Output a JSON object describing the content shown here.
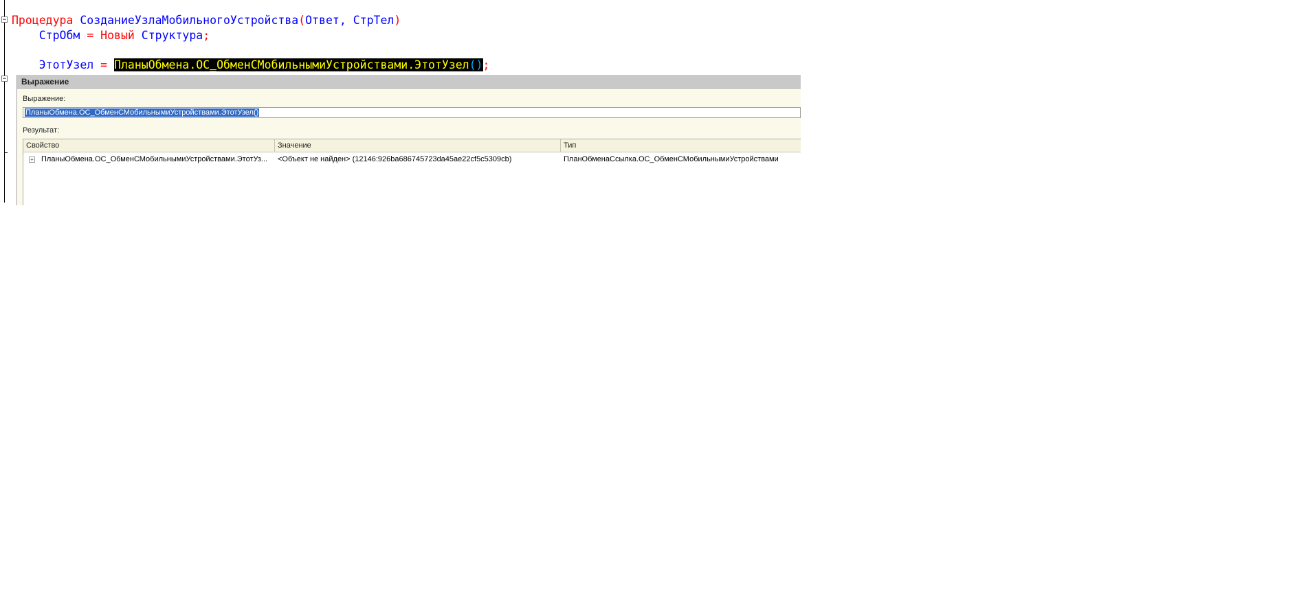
{
  "editor": {
    "line1": {
      "keyword": "Процедура",
      "name": "СозданиеУзлаМобильногоУстройства",
      "open_paren": "(",
      "params": "Ответ, СтрТел",
      "close_paren": ")"
    },
    "line2": {
      "var": "СтрОбм",
      "eq": "=",
      "new_kw": "Новый",
      "type": "Структура",
      "semicolon": ";"
    },
    "line3": {
      "var": "ЭтотУзел",
      "eq": "=",
      "sel_part1": "ПланыОбмена.ОС",
      "sel_underscore": "_",
      "sel_part2": "ОбменСМобильнымиУстройствами.ЭтотУзел",
      "sel_parens": "()",
      "semicolon": ";"
    },
    "fold_symbol": "−"
  },
  "dialog": {
    "title": "Выражение",
    "expression_label": "Выражение:",
    "expression_value": "ПланыОбмена.ОС_ОбменСМобильнымиУстройствами.ЭтотУзел()",
    "result_label": "Результат:",
    "columns": [
      "Свойство",
      "Значение",
      "Тип"
    ],
    "rows": [
      {
        "expand_symbol": "+",
        "property": "ПланыОбмена.ОС_ОбменСМобильнымиУстройствами.ЭтотУз...",
        "value": "<Объект не найден> (12146:926ba686745723da45ae22cf5c5309cb)",
        "type": "ПланОбменаСсылка.ОС_ОбменСМобильнымиУстройствами"
      }
    ]
  }
}
